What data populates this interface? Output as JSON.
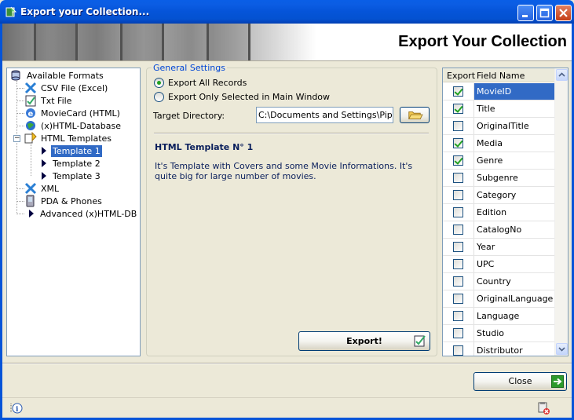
{
  "window": {
    "title": "Export your Collection..."
  },
  "header": {
    "title": "Export Your Collection"
  },
  "tree": {
    "root": "Available Formats",
    "items": [
      {
        "label": "CSV File (Excel)",
        "icon": "csv-icon"
      },
      {
        "label": "Txt File",
        "icon": "txt-file-icon"
      },
      {
        "label": "MovieCard (HTML)",
        "icon": "ie-icon"
      },
      {
        "label": "(x)HTML-Database",
        "icon": "globe-icon"
      },
      {
        "label": "HTML Templates",
        "icon": "html-templates-icon",
        "children": [
          "Template 1",
          "Template 2",
          "Template 3"
        ]
      },
      {
        "label": "XML",
        "icon": "xml-icon"
      },
      {
        "label": "PDA & Phones",
        "icon": "pda-icon"
      },
      {
        "label": "Advanced (x)HTML-DB",
        "icon": "arrow-icon"
      }
    ],
    "selected": "Template 1"
  },
  "general": {
    "legend": "General Settings",
    "radio_all": "Export All Records",
    "radio_selected": "Export Only Selected in Main Window",
    "radio_value": "all",
    "target_label": "Target Directory:",
    "target_value": "C:\\Documents and Settings\\Pippo\\D"
  },
  "template": {
    "heading": "HTML Template N° 1",
    "description": "It's Template with Covers and some Movie Informations. It's quite big for large number of movies."
  },
  "buttons": {
    "export": "Export!",
    "close": "Close"
  },
  "fields": {
    "col_export": "Export",
    "col_name": "Field Name",
    "rows": [
      {
        "name": "MovieID",
        "checked": true,
        "selected": true
      },
      {
        "name": "Title",
        "checked": true
      },
      {
        "name": "OriginalTitle",
        "checked": false
      },
      {
        "name": "Media",
        "checked": true
      },
      {
        "name": "Genre",
        "checked": true
      },
      {
        "name": "Subgenre",
        "checked": false
      },
      {
        "name": "Category",
        "checked": false
      },
      {
        "name": "Edition",
        "checked": false
      },
      {
        "name": "CatalogNo",
        "checked": false
      },
      {
        "name": "Year",
        "checked": false
      },
      {
        "name": "UPC",
        "checked": false
      },
      {
        "name": "Country",
        "checked": false
      },
      {
        "name": "OriginalLanguage",
        "checked": false
      },
      {
        "name": "Language",
        "checked": false
      },
      {
        "name": "Studio",
        "checked": false
      },
      {
        "name": "Distributor",
        "checked": false
      }
    ]
  }
}
